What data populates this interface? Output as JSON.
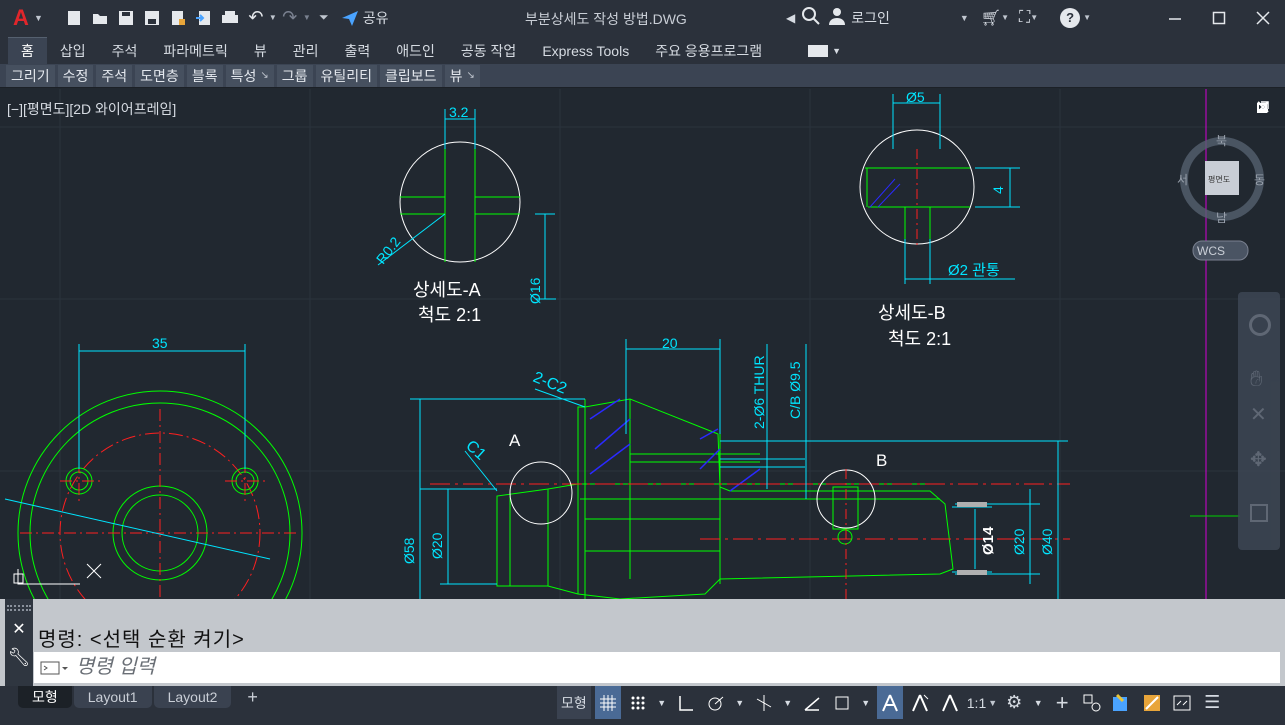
{
  "app": {
    "logo": "A",
    "document_title": "부분상세도 작성 방법.DWG",
    "share_label": "공유",
    "login_label": "로그인",
    "help_label": "?"
  },
  "ribbon": {
    "tabs": [
      "홈",
      "삽입",
      "주석",
      "파라메트릭",
      "뷰",
      "관리",
      "출력",
      "애드인",
      "공동 작업",
      "Express Tools",
      "주요 응용프로그램"
    ],
    "active_tab": 0,
    "panels": [
      "그리기",
      "수정",
      "주석",
      "도면층",
      "블록",
      "특성",
      "그룹",
      "유틸리티",
      "클립보드",
      "뷰"
    ]
  },
  "viewport": {
    "label": "[−][평면도][2D 와이어프레임]",
    "viewcube": {
      "top": "평면도",
      "north": "북",
      "south": "남",
      "east": "동",
      "west": "서",
      "ucs": "WCS"
    }
  },
  "drawing": {
    "detail_a": {
      "title": "상세도-A",
      "scale": "척도 2:1",
      "dim_width": "3.2",
      "dim_radius": "R0.2",
      "dim_height": "Ø16"
    },
    "detail_b": {
      "title": "상세도-B",
      "scale": "척도 2:1",
      "dim_width": "Ø5",
      "dim_height": "4",
      "dim_hole": "Ø2 관통"
    },
    "flange": {
      "dim_width": "35"
    },
    "section": {
      "dim_top": "20",
      "chamfer_big": "2-C2",
      "chamfer_small": "C1",
      "hole_note": "2-Ø6 THUR",
      "cb_note": "C/B Ø9.5",
      "marker_a": "A",
      "marker_b": "B",
      "dim_58": "Ø58",
      "dim_20_left": "Ø20",
      "dim_14": "Ø14",
      "dim_20_right": "Ø20",
      "dim_40": "Ø40"
    }
  },
  "command": {
    "history": "명령:  <선택 순환 켜기>",
    "placeholder": "명령 입력"
  },
  "status": {
    "layout_tabs": [
      "모형",
      "Layout1",
      "Layout2"
    ],
    "add_tab": "+",
    "model_button": "모형",
    "scale": "1:1"
  },
  "colors": {
    "background": "#212830",
    "geometry": "#00ff00",
    "dimension": "#00e5ff",
    "centerline": "#ff2020",
    "hatch": "#2a2aff",
    "text": "#ffffff"
  }
}
